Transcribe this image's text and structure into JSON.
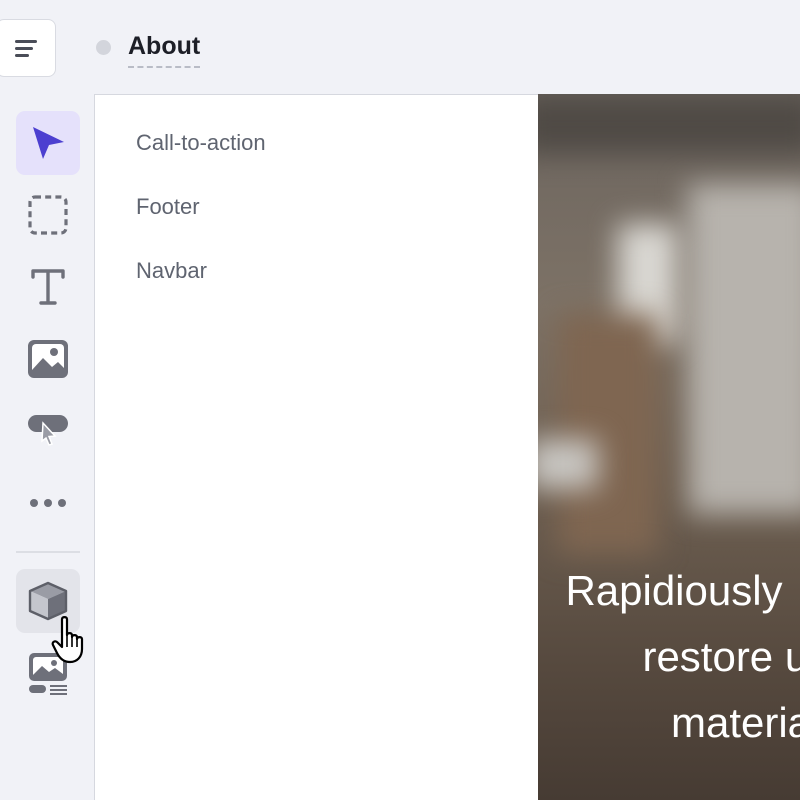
{
  "header": {
    "title": "About",
    "menu_icon": "hamburger-menu-icon",
    "status_color": "#d3d5dc"
  },
  "toolbar": {
    "tools": [
      {
        "name": "select",
        "icon": "cursor-arrow-icon",
        "active": true
      },
      {
        "name": "box",
        "icon": "dashed-box-icon"
      },
      {
        "name": "text",
        "icon": "text-icon"
      },
      {
        "name": "image",
        "icon": "image-icon"
      },
      {
        "name": "button",
        "icon": "button-icon"
      },
      {
        "name": "more",
        "icon": "more-dots-icon"
      },
      {
        "name": "components",
        "icon": "cube-icon",
        "hovered": true
      },
      {
        "name": "sections",
        "icon": "image-section-icon"
      }
    ],
    "accent_color": "#4c3fd0"
  },
  "panel": {
    "items": [
      "Call-to-action",
      "Footer",
      "Navbar"
    ]
  },
  "preview": {
    "hero_lines": [
      "Rapidiously",
      "restore user-c",
      "materia"
    ]
  }
}
